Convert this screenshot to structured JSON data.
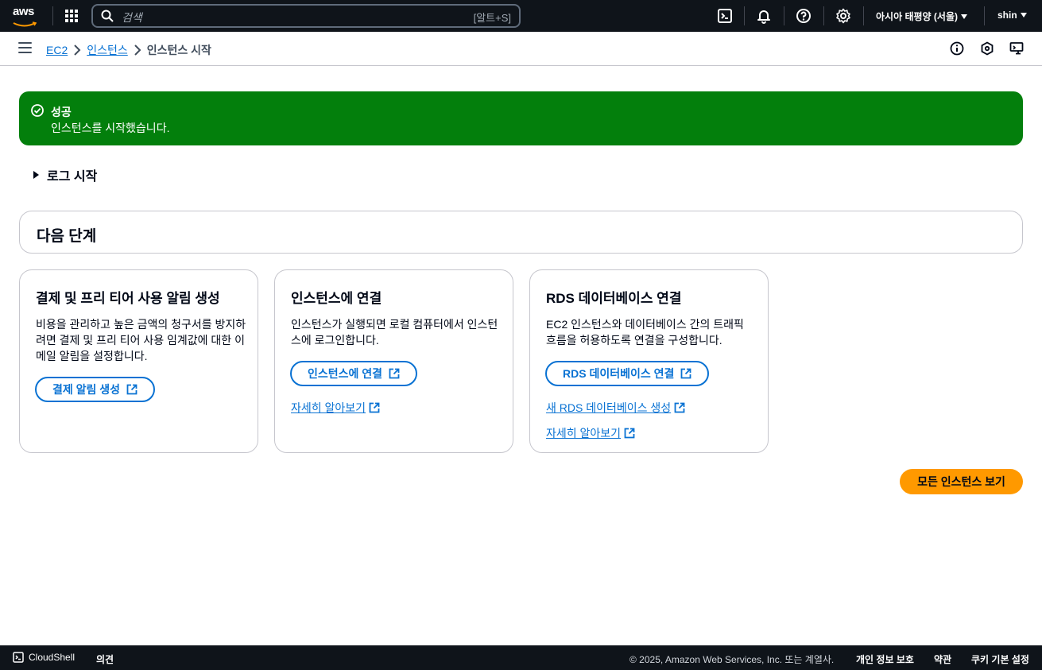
{
  "topbar": {
    "logo_text": "aws",
    "search_placeholder": "검색",
    "search_shortcut": "[알트+S]",
    "region": "아시아 태평양 (서울)",
    "user": "shin"
  },
  "breadcrumb": {
    "items": [
      "EC2",
      "인스턴스"
    ],
    "current": "인스턴스 시작"
  },
  "flash": {
    "title": "성공",
    "message": "인스턴스를 시작했습니다.",
    "color": "#037f0c"
  },
  "log_expander": {
    "label": "로그 시작"
  },
  "next_steps": {
    "heading": "다음 단계",
    "cards": [
      {
        "title": "결제 및 프리 티어 사용 알림 생성",
        "description": "비용을 관리하고 높은 금액의 청구서를 방지하려면 결제 및 프리 티어 사용 임계값에 대한 이메일 알림을 설정합니다.",
        "button": "결제 알림 생성"
      },
      {
        "title": "인스턴스에 연결",
        "description": "인스턴스가 실행되면 로컬 컴퓨터에서 인스턴스에 로그인합니다.",
        "button": "인스턴스에 연결",
        "link1": "자세히 알아보기"
      },
      {
        "title": "RDS 데이터베이스 연결",
        "description": "EC2 인스턴스와 데이터베이스 간의 트래픽 흐름을 허용하도록 연결을 구성합니다.",
        "button": "RDS 데이터베이스 연결",
        "link1": "새 RDS 데이터베이스 생성",
        "link2": "자세히 알아보기"
      }
    ]
  },
  "primary_button": {
    "label": "모든 인스턴스 보기",
    "color": "#ff9900"
  },
  "footer": {
    "cloudshell": "CloudShell",
    "feedback": "의견",
    "copyright": "© 2025, Amazon Web Services, Inc. 또는 계열사.",
    "links": [
      "개인 정보 보호",
      "약관",
      "쿠키 기본 설정"
    ]
  },
  "icons": [
    "grid-icon",
    "search-icon",
    "cloudshell-icon",
    "bell-icon",
    "help-icon",
    "settings-icon",
    "menu-icon",
    "info-icon",
    "hexagon-icon",
    "monitor-icon",
    "success-icon",
    "external-link-icon"
  ]
}
